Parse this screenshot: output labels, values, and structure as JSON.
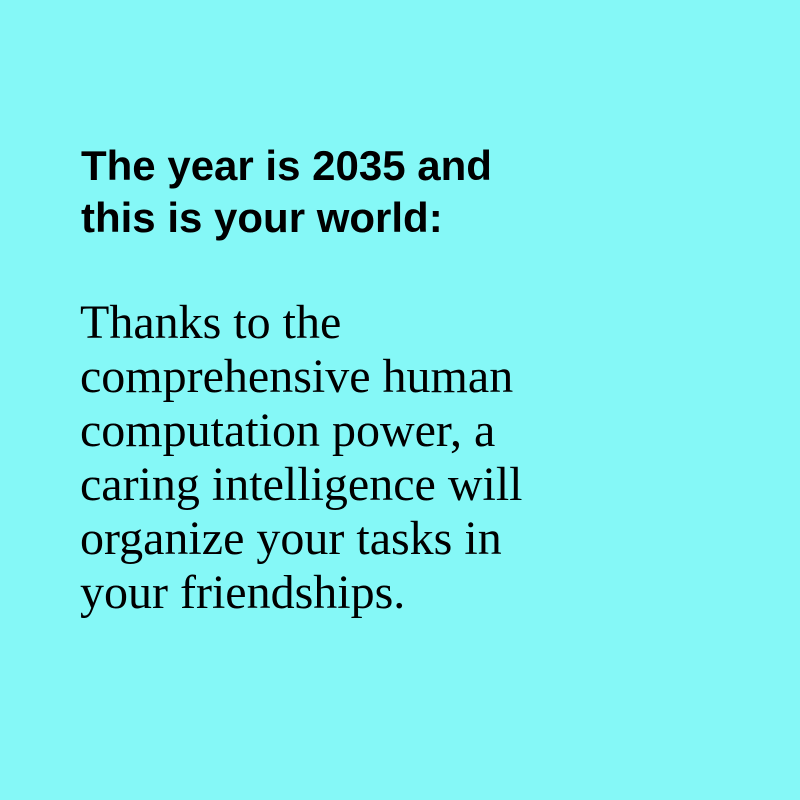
{
  "background_color": "#85f8f7",
  "text_color": "#000000",
  "heading": {
    "lines": [
      "The year is 2035 and",
      "this is your world:"
    ]
  },
  "body": {
    "lines": [
      "Thanks to the",
      "comprehensive human",
      "computation power, a",
      "caring intelligence will",
      "organize your tasks in",
      "your friendships."
    ]
  }
}
